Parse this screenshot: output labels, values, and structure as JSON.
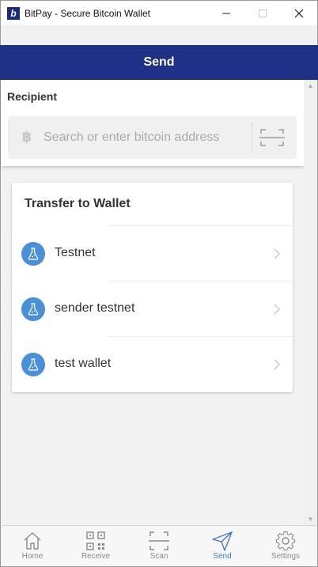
{
  "window": {
    "title": "BitPay - Secure Bitcoin Wallet",
    "logo_letter": "b",
    "minimize": "—",
    "maximize": "☐",
    "close": "✕"
  },
  "header": {
    "title": "Send"
  },
  "recipient": {
    "label": "Recipient",
    "placeholder": "Search or enter bitcoin address",
    "currency_symbol": "฿"
  },
  "transfer": {
    "title": "Transfer to Wallet",
    "wallets": [
      {
        "name": "Testnet",
        "icon": "flask-icon"
      },
      {
        "name": "sender testnet",
        "icon": "flask-icon"
      },
      {
        "name": "test wallet",
        "icon": "flask-icon"
      }
    ]
  },
  "tabs": [
    {
      "label": "Home",
      "icon": "home-icon",
      "active": false
    },
    {
      "label": "Receive",
      "icon": "qr-code-icon",
      "active": false
    },
    {
      "label": "Scan",
      "icon": "scan-icon",
      "active": false
    },
    {
      "label": "Send",
      "icon": "send-icon",
      "active": true
    },
    {
      "label": "Settings",
      "icon": "gear-icon",
      "active": false
    }
  ],
  "colors": {
    "header_bg": "#1e3186",
    "accent": "#4a90d9",
    "active_tab": "#4a7ac7",
    "inactive_tab": "#8a8a8a"
  }
}
